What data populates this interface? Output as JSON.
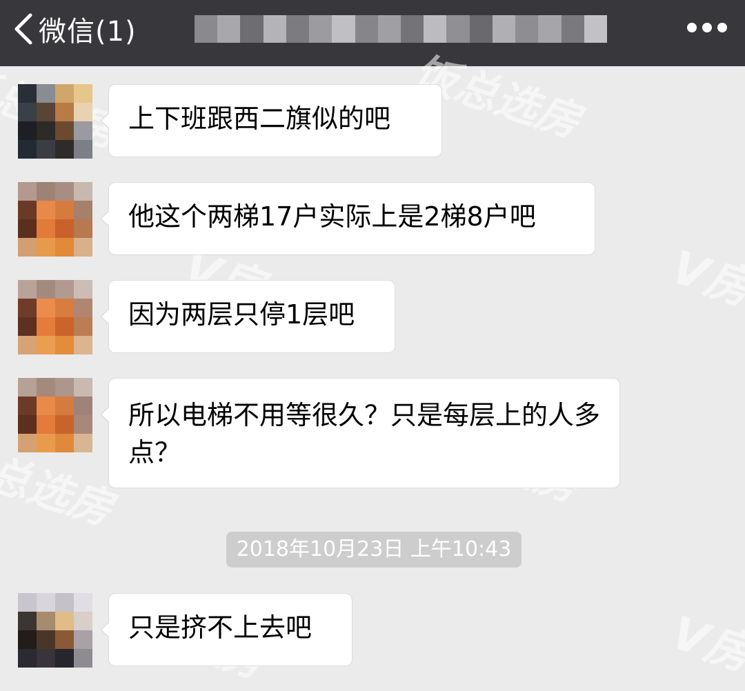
{
  "nav": {
    "back_label": "微信(1)",
    "title_mosaic": [
      "#8a8a8e",
      "#a8a8ac",
      "#6e6e72",
      "#b4b4b8",
      "#7c7c80",
      "#9c9ca0",
      "#c0c0c4",
      "#86868a",
      "#a0a0a4",
      "#747478",
      "#bcbcc0",
      "#909094",
      "#6a6a6e",
      "#b0b0b4",
      "#8e8e92",
      "#a6a6aa",
      "#7a7a7e",
      "#c2c2c6"
    ],
    "more_icon": "more-horizontal-icon",
    "background": "#38383c"
  },
  "watermark": {
    "brand_text": "饭总选房",
    "logo_text": "V房"
  },
  "messages": [
    {
      "text": "上下班跟西二旗似的吧",
      "avatar_colors": [
        "#2a2e36",
        "#8a8c92",
        "#d0a66a",
        "#e6c68a",
        "#3b3f48",
        "#5a4436",
        "#b87b45",
        "#e8d2b0",
        "#1d1f24",
        "#2d2a27",
        "#6b4a30",
        "#9a9aa0",
        "#232a34",
        "#3a3d44",
        "#2f2b2a",
        "#7d7f86"
      ]
    },
    {
      "text": "他这个两梯17户实际上是2梯8户吧",
      "avatar_colors": [
        "#b49a8e",
        "#9d8275",
        "#a88e82",
        "#c9b8ae",
        "#6a3a26",
        "#e8894a",
        "#d67a3e",
        "#a5806a",
        "#5c2e1e",
        "#e27a38",
        "#c8612a",
        "#b87850",
        "#d2a070",
        "#e89a4c",
        "#e08a3a",
        "#d8b08a"
      ]
    },
    {
      "text": "因为两层只停1层吧",
      "avatar_colors": [
        "#b8a39a",
        "#a48a7e",
        "#b29a90",
        "#cbbcb4",
        "#6e3c28",
        "#ec8c4c",
        "#d87c40",
        "#b08670",
        "#5e301f",
        "#e47c3a",
        "#cb642c",
        "#bc7c54",
        "#d6a474",
        "#ec9e50",
        "#e28c3c",
        "#dcb48e"
      ]
    },
    {
      "text": "所以电梯不用等很久？只是每层上的人多点？",
      "avatar_colors": [
        "#b6a196",
        "#a4897c",
        "#ae968c",
        "#cab9b0",
        "#6c3b27",
        "#ea8a4a",
        "#d67a3e",
        "#9e8478",
        "#5d2f1e",
        "#e37b39",
        "#c9632b",
        "#a88878",
        "#d4a272",
        "#e99b4d",
        "#df8a3b",
        "#d8b694"
      ]
    },
    {
      "text": "只是挤不上去吧",
      "avatar_colors": [
        "#c8c6cc",
        "#d8d6dc",
        "#c4c2c8",
        "#e0dee2",
        "#3c3632",
        "#a88a6c",
        "#e0bc88",
        "#d8cfc6",
        "#221c1a",
        "#4a3628",
        "#8a5a36",
        "#a8a2a6",
        "#2a2a30",
        "#38343a",
        "#26262c",
        "#8e8c92"
      ]
    }
  ],
  "timestamp": "2018年10月23日 上午10:43"
}
